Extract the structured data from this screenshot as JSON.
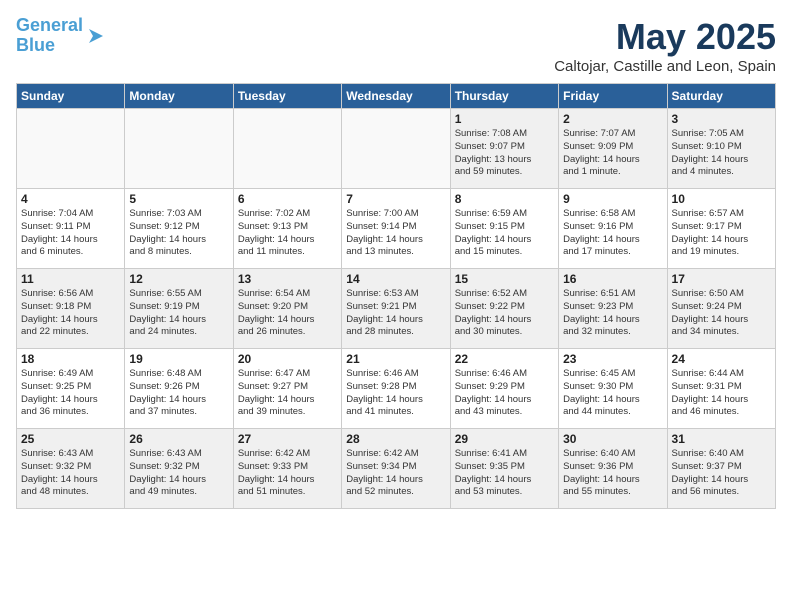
{
  "logo": {
    "line1": "General",
    "line2": "Blue"
  },
  "title": "May 2025",
  "subtitle": "Caltojar, Castille and Leon, Spain",
  "weekdays": [
    "Sunday",
    "Monday",
    "Tuesday",
    "Wednesday",
    "Thursday",
    "Friday",
    "Saturday"
  ],
  "weeks": [
    [
      {
        "day": "",
        "info": ""
      },
      {
        "day": "",
        "info": ""
      },
      {
        "day": "",
        "info": ""
      },
      {
        "day": "",
        "info": ""
      },
      {
        "day": "1",
        "info": "Sunrise: 7:08 AM\nSunset: 9:07 PM\nDaylight: 13 hours\nand 59 minutes."
      },
      {
        "day": "2",
        "info": "Sunrise: 7:07 AM\nSunset: 9:09 PM\nDaylight: 14 hours\nand 1 minute."
      },
      {
        "day": "3",
        "info": "Sunrise: 7:05 AM\nSunset: 9:10 PM\nDaylight: 14 hours\nand 4 minutes."
      }
    ],
    [
      {
        "day": "4",
        "info": "Sunrise: 7:04 AM\nSunset: 9:11 PM\nDaylight: 14 hours\nand 6 minutes."
      },
      {
        "day": "5",
        "info": "Sunrise: 7:03 AM\nSunset: 9:12 PM\nDaylight: 14 hours\nand 8 minutes."
      },
      {
        "day": "6",
        "info": "Sunrise: 7:02 AM\nSunset: 9:13 PM\nDaylight: 14 hours\nand 11 minutes."
      },
      {
        "day": "7",
        "info": "Sunrise: 7:00 AM\nSunset: 9:14 PM\nDaylight: 14 hours\nand 13 minutes."
      },
      {
        "day": "8",
        "info": "Sunrise: 6:59 AM\nSunset: 9:15 PM\nDaylight: 14 hours\nand 15 minutes."
      },
      {
        "day": "9",
        "info": "Sunrise: 6:58 AM\nSunset: 9:16 PM\nDaylight: 14 hours\nand 17 minutes."
      },
      {
        "day": "10",
        "info": "Sunrise: 6:57 AM\nSunset: 9:17 PM\nDaylight: 14 hours\nand 19 minutes."
      }
    ],
    [
      {
        "day": "11",
        "info": "Sunrise: 6:56 AM\nSunset: 9:18 PM\nDaylight: 14 hours\nand 22 minutes."
      },
      {
        "day": "12",
        "info": "Sunrise: 6:55 AM\nSunset: 9:19 PM\nDaylight: 14 hours\nand 24 minutes."
      },
      {
        "day": "13",
        "info": "Sunrise: 6:54 AM\nSunset: 9:20 PM\nDaylight: 14 hours\nand 26 minutes."
      },
      {
        "day": "14",
        "info": "Sunrise: 6:53 AM\nSunset: 9:21 PM\nDaylight: 14 hours\nand 28 minutes."
      },
      {
        "day": "15",
        "info": "Sunrise: 6:52 AM\nSunset: 9:22 PM\nDaylight: 14 hours\nand 30 minutes."
      },
      {
        "day": "16",
        "info": "Sunrise: 6:51 AM\nSunset: 9:23 PM\nDaylight: 14 hours\nand 32 minutes."
      },
      {
        "day": "17",
        "info": "Sunrise: 6:50 AM\nSunset: 9:24 PM\nDaylight: 14 hours\nand 34 minutes."
      }
    ],
    [
      {
        "day": "18",
        "info": "Sunrise: 6:49 AM\nSunset: 9:25 PM\nDaylight: 14 hours\nand 36 minutes."
      },
      {
        "day": "19",
        "info": "Sunrise: 6:48 AM\nSunset: 9:26 PM\nDaylight: 14 hours\nand 37 minutes."
      },
      {
        "day": "20",
        "info": "Sunrise: 6:47 AM\nSunset: 9:27 PM\nDaylight: 14 hours\nand 39 minutes."
      },
      {
        "day": "21",
        "info": "Sunrise: 6:46 AM\nSunset: 9:28 PM\nDaylight: 14 hours\nand 41 minutes."
      },
      {
        "day": "22",
        "info": "Sunrise: 6:46 AM\nSunset: 9:29 PM\nDaylight: 14 hours\nand 43 minutes."
      },
      {
        "day": "23",
        "info": "Sunrise: 6:45 AM\nSunset: 9:30 PM\nDaylight: 14 hours\nand 44 minutes."
      },
      {
        "day": "24",
        "info": "Sunrise: 6:44 AM\nSunset: 9:31 PM\nDaylight: 14 hours\nand 46 minutes."
      }
    ],
    [
      {
        "day": "25",
        "info": "Sunrise: 6:43 AM\nSunset: 9:32 PM\nDaylight: 14 hours\nand 48 minutes."
      },
      {
        "day": "26",
        "info": "Sunrise: 6:43 AM\nSunset: 9:32 PM\nDaylight: 14 hours\nand 49 minutes."
      },
      {
        "day": "27",
        "info": "Sunrise: 6:42 AM\nSunset: 9:33 PM\nDaylight: 14 hours\nand 51 minutes."
      },
      {
        "day": "28",
        "info": "Sunrise: 6:42 AM\nSunset: 9:34 PM\nDaylight: 14 hours\nand 52 minutes."
      },
      {
        "day": "29",
        "info": "Sunrise: 6:41 AM\nSunset: 9:35 PM\nDaylight: 14 hours\nand 53 minutes."
      },
      {
        "day": "30",
        "info": "Sunrise: 6:40 AM\nSunset: 9:36 PM\nDaylight: 14 hours\nand 55 minutes."
      },
      {
        "day": "31",
        "info": "Sunrise: 6:40 AM\nSunset: 9:37 PM\nDaylight: 14 hours\nand 56 minutes."
      }
    ]
  ]
}
